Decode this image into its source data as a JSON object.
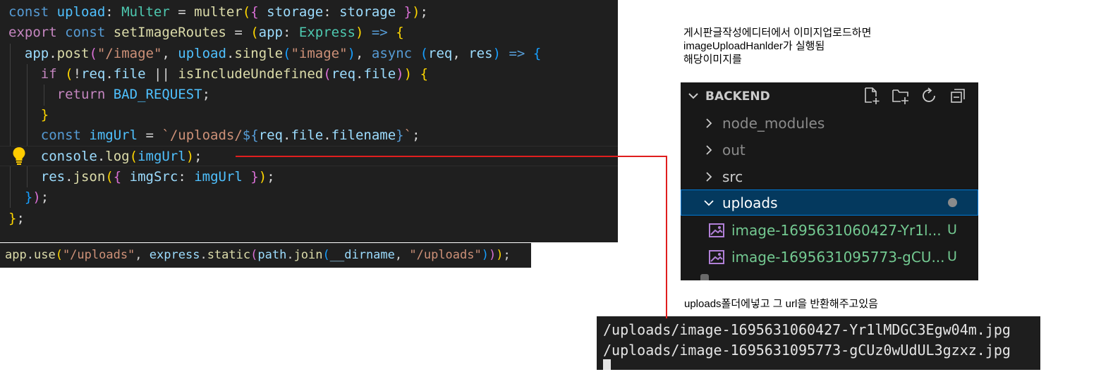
{
  "editor": {
    "lines": [
      [
        [
          "kw",
          "const "
        ],
        [
          "cnst",
          "upload"
        ],
        [
          "punc",
          ": "
        ],
        [
          "type",
          "Multer"
        ],
        [
          "punc",
          " = "
        ],
        [
          "fn",
          "multer"
        ],
        [
          "br1",
          "("
        ],
        [
          "br2",
          "{"
        ],
        [
          "punc",
          " "
        ],
        [
          "var",
          "storage"
        ],
        [
          "punc",
          ": "
        ],
        [
          "var",
          "storage"
        ],
        [
          "punc",
          " "
        ],
        [
          "br2",
          "}"
        ],
        [
          "br1",
          ")"
        ],
        [
          "punc",
          ";"
        ]
      ],
      [
        [
          "ctrl",
          "export "
        ],
        [
          "kw",
          "const "
        ],
        [
          "fn",
          "setImageRoutes"
        ],
        [
          "punc",
          " = "
        ],
        [
          "br1",
          "("
        ],
        [
          "var",
          "app"
        ],
        [
          "punc",
          ": "
        ],
        [
          "type",
          "Express"
        ],
        [
          "br1",
          ")"
        ],
        [
          "punc",
          " "
        ],
        [
          "kw",
          "=>"
        ],
        [
          "punc",
          " "
        ],
        [
          "br1",
          "{"
        ]
      ],
      [
        [
          "punc",
          "  "
        ],
        [
          "var",
          "app"
        ],
        [
          "punc",
          "."
        ],
        [
          "fn",
          "post"
        ],
        [
          "br2",
          "("
        ],
        [
          "str",
          "\"/image\""
        ],
        [
          "punc",
          ", "
        ],
        [
          "cnst",
          "upload"
        ],
        [
          "punc",
          "."
        ],
        [
          "fn",
          "single"
        ],
        [
          "br3",
          "("
        ],
        [
          "str",
          "\"image\""
        ],
        [
          "br3",
          ")"
        ],
        [
          "punc",
          ", "
        ],
        [
          "kw",
          "async"
        ],
        [
          "punc",
          " "
        ],
        [
          "br3",
          "("
        ],
        [
          "var",
          "req"
        ],
        [
          "punc",
          ", "
        ],
        [
          "var",
          "res"
        ],
        [
          "br3",
          ")"
        ],
        [
          "punc",
          " "
        ],
        [
          "kw",
          "=>"
        ],
        [
          "punc",
          " "
        ],
        [
          "br3",
          "{"
        ]
      ],
      [
        [
          "punc",
          "    "
        ],
        [
          "ctrl",
          "if"
        ],
        [
          "punc",
          " "
        ],
        [
          "br1",
          "("
        ],
        [
          "punc",
          "!"
        ],
        [
          "var",
          "req"
        ],
        [
          "punc",
          "."
        ],
        [
          "var",
          "file"
        ],
        [
          "punc",
          " || "
        ],
        [
          "fn",
          "isIncludeUndefined"
        ],
        [
          "br2",
          "("
        ],
        [
          "var",
          "req"
        ],
        [
          "punc",
          "."
        ],
        [
          "var",
          "file"
        ],
        [
          "br2",
          ")"
        ],
        [
          "br1",
          ")"
        ],
        [
          "punc",
          " "
        ],
        [
          "br1",
          "{"
        ]
      ],
      [
        [
          "punc",
          "      "
        ],
        [
          "ctrl",
          "return"
        ],
        [
          "punc",
          " "
        ],
        [
          "cnst",
          "BAD_REQUEST"
        ],
        [
          "punc",
          ";"
        ]
      ],
      [
        [
          "punc",
          "    "
        ],
        [
          "br1",
          "}"
        ]
      ],
      [
        [
          "punc",
          "    "
        ],
        [
          "kw",
          "const "
        ],
        [
          "cnst",
          "imgUrl"
        ],
        [
          "punc",
          " = "
        ],
        [
          "str",
          "`/uploads/"
        ],
        [
          "tpl",
          "${"
        ],
        [
          "var",
          "req"
        ],
        [
          "punc",
          "."
        ],
        [
          "var",
          "file"
        ],
        [
          "punc",
          "."
        ],
        [
          "var",
          "filename"
        ],
        [
          "tpl",
          "}"
        ],
        [
          "str",
          "`"
        ],
        [
          "punc",
          ";"
        ]
      ],
      [
        [
          "punc",
          "    "
        ],
        [
          "var",
          "console"
        ],
        [
          "punc",
          "."
        ],
        [
          "fn",
          "log"
        ],
        [
          "br1",
          "("
        ],
        [
          "cnst",
          "imgUrl"
        ],
        [
          "br1",
          ")"
        ],
        [
          "punc",
          ";"
        ]
      ],
      [
        [
          "punc",
          "    "
        ],
        [
          "var",
          "res"
        ],
        [
          "punc",
          "."
        ],
        [
          "fn",
          "json"
        ],
        [
          "br1",
          "("
        ],
        [
          "br2",
          "{"
        ],
        [
          "punc",
          " "
        ],
        [
          "var",
          "imgSrc"
        ],
        [
          "punc",
          ": "
        ],
        [
          "cnst",
          "imgUrl"
        ],
        [
          "punc",
          " "
        ],
        [
          "br2",
          "}"
        ],
        [
          "br1",
          ")"
        ],
        [
          "punc",
          ";"
        ]
      ],
      [
        [
          "punc",
          "  "
        ],
        [
          "br3",
          "}"
        ],
        [
          "br2",
          ")"
        ],
        [
          "punc",
          ";"
        ]
      ],
      [
        [
          "br1",
          "}"
        ],
        [
          "punc",
          ";"
        ]
      ]
    ]
  },
  "snippet": {
    "tokens": [
      [
        "fn",
        "app"
      ],
      [
        "punc",
        "."
      ],
      [
        "fn",
        "use"
      ],
      [
        "br1",
        "("
      ],
      [
        "str",
        "\"/uploads\""
      ],
      [
        "punc",
        ", "
      ],
      [
        "var",
        "express"
      ],
      [
        "punc",
        "."
      ],
      [
        "fn",
        "static"
      ],
      [
        "br2",
        "("
      ],
      [
        "var",
        "path"
      ],
      [
        "punc",
        "."
      ],
      [
        "fn",
        "join"
      ],
      [
        "br3",
        "("
      ],
      [
        "var",
        "__dirname"
      ],
      [
        "punc",
        ", "
      ],
      [
        "str",
        "\"/uploads\""
      ],
      [
        "br3",
        ")"
      ],
      [
        "br2",
        ")"
      ],
      [
        "br1",
        ")"
      ],
      [
        "punc",
        ";"
      ]
    ]
  },
  "annotations": {
    "top_note_line1": "게시판글작성에디터에서 이미지업로드하면",
    "top_note_line2": "imageUploadHanlder가 실행됨",
    "top_note_line3": "해당이미지를",
    "bottom_note": "uploads폴더에넣고 그 url을 반환해주고있음"
  },
  "explorer": {
    "title": "BACKEND",
    "header_icons": [
      "new-file-icon",
      "new-folder-icon",
      "refresh-icon",
      "collapse-all-icon"
    ],
    "items": [
      {
        "label": "node_modules",
        "expanded": false
      },
      {
        "label": "out",
        "expanded": false
      },
      {
        "label": "src",
        "expanded": false
      },
      {
        "label": "uploads",
        "expanded": true,
        "selected": true
      }
    ],
    "files": [
      {
        "label": "image-1695631060427-Yr1l...",
        "status": "U"
      },
      {
        "label": "image-1695631095773-gCU...",
        "status": "U"
      }
    ]
  },
  "terminal": {
    "lines": [
      "/uploads/image-1695631060427-Yr1lMDGC3Egw04m.jpg",
      "/uploads/image-1695631095773-gCUz0wUdUL3gzxz.jpg"
    ]
  },
  "colors": {
    "editor_bg": "#1f1f1f",
    "connector": "#e01e1e",
    "explorer_selected": "#04395e",
    "git_untracked": "#73c991"
  }
}
